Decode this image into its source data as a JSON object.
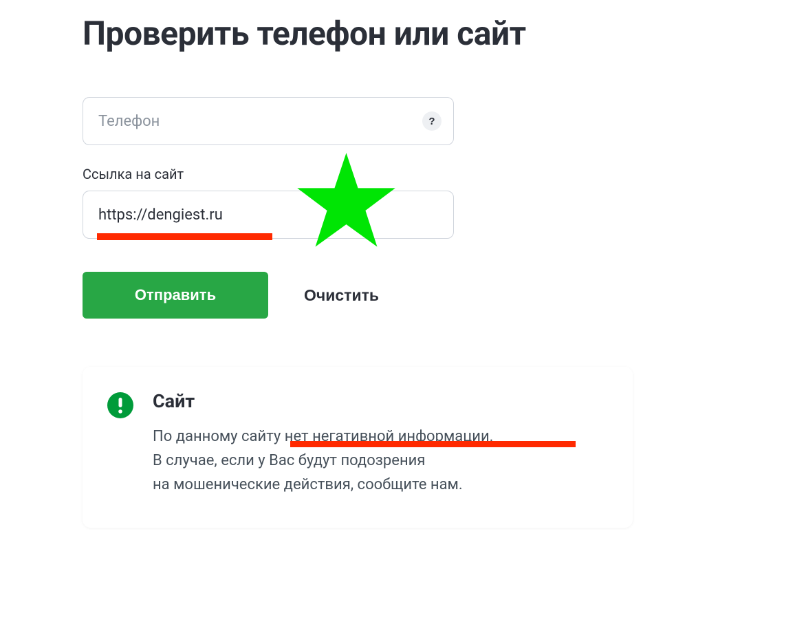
{
  "page": {
    "title": "Проверить телефон или сайт"
  },
  "form": {
    "phone": {
      "placeholder": "Телефон",
      "value": "",
      "help": "?"
    },
    "site": {
      "label": "Ссылка на сайт",
      "value": "https://dengiest.ru"
    },
    "submit_label": "Отправить",
    "clear_label": "Очистить"
  },
  "result": {
    "title": "Сайт",
    "line1": "По данному сайту нет негативной информации.",
    "line2": "В случае, если у Вас будут подозрения",
    "line3": "на мошенические действия, сообщите нам."
  },
  "annotations": {
    "underline_color": "#ff2a00",
    "star_color": "#00e504"
  }
}
